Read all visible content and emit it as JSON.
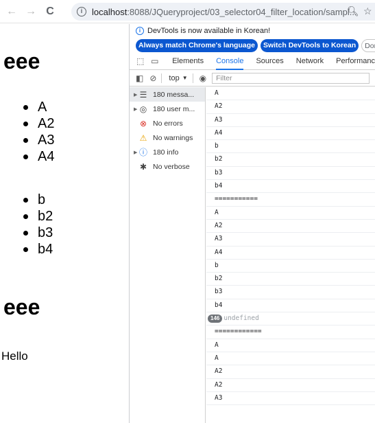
{
  "browser": {
    "back_icon": "arrow-left-icon",
    "forward_icon": "arrow-right-icon",
    "reload_icon": "reload-icon",
    "url_host": "localhost",
    "url_rest": ":8088/JQueryproject/03_selector04_filter_location/sampl...",
    "zoom_icon": "zoom-icon",
    "star_icon": "star-icon"
  },
  "page": {
    "heading1": "eee",
    "list1": [
      "A",
      "A2",
      "A3",
      "A4"
    ],
    "list2": [
      "b",
      "b2",
      "b3",
      "b4"
    ],
    "heading2": "eee",
    "paragraph": "Hello"
  },
  "devtools": {
    "notice": "DevTools is now available in Korean!",
    "btn_match": "Always match Chrome's language",
    "btn_switch": "Switch DevTools to Korean",
    "btn_dont": "Don't sh",
    "tabs": [
      "Elements",
      "Console",
      "Sources",
      "Network",
      "Performanc"
    ],
    "active_tab": "Console",
    "context": "top",
    "filter_placeholder": "Filter",
    "sidebar": [
      {
        "label": "180 messa...",
        "icon": "list-icon",
        "caret": true
      },
      {
        "label": "180 user m...",
        "icon": "user-icon",
        "caret": true
      },
      {
        "label": "No errors",
        "icon": "error-icon",
        "caret": false
      },
      {
        "label": "No warnings",
        "icon": "warning-icon",
        "caret": false
      },
      {
        "label": "180 info",
        "icon": "info-icon",
        "caret": true
      },
      {
        "label": "No verbose",
        "icon": "bug-icon",
        "caret": false
      }
    ],
    "console_rows": [
      "A",
      "A2",
      "A3",
      "A4",
      "b",
      "b2",
      "b3",
      "b4",
      "===========",
      "A",
      "A2",
      "A3",
      "A4",
      "b",
      "b2",
      "b3",
      "b4"
    ],
    "result_badge": "146",
    "result_text": "undefined",
    "console_rows2": [
      "============",
      "A",
      "A",
      "A2",
      "A2",
      "A3"
    ]
  }
}
